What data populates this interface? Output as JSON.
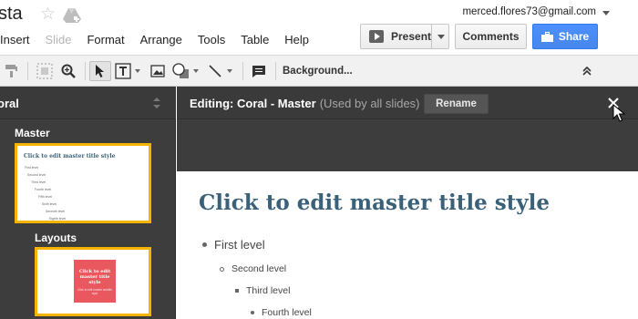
{
  "app": {
    "doc_title": "sta",
    "account_email": "merced.flores73@gmail.com"
  },
  "icons": {
    "star": "star-icon",
    "drive": "drive-icon",
    "present": "play-icon",
    "share": "share-icon",
    "close": "close-icon"
  },
  "menu": {
    "items": [
      "Insert",
      "Slide",
      "Format",
      "Arrange",
      "Tools",
      "Table",
      "Help"
    ],
    "disabled": [
      "Slide"
    ]
  },
  "header_buttons": {
    "present_label": "Present",
    "comments_label": "Comments",
    "share_label": "Share"
  },
  "toolbar": {
    "background_label": "Background..."
  },
  "left_panel": {
    "title": "oral",
    "master_heading": "Master",
    "layouts_heading": "Layouts",
    "master_thumb": {
      "title": "Click to edit master title style",
      "levels": [
        "First level",
        "Second level",
        "Third level",
        "Fourth level",
        "Fifth level",
        "Sixth level",
        "Seventh level",
        "Eighth level",
        "Ninth level"
      ]
    },
    "layout_thumb": {
      "title": "Click to edit master title style",
      "subtitle": "Click to edit master subtitle style"
    }
  },
  "editing_bar": {
    "title": "Editing: Coral - Master",
    "subtitle": "(Used by all slides)",
    "rename_label": "Rename"
  },
  "slide": {
    "title": "Click to edit master title style",
    "levels": [
      "First level",
      "Second level",
      "Third level",
      "Fourth level"
    ]
  },
  "colors": {
    "accent_yellow": "#f4b400",
    "share_blue": "#4d90fe",
    "slide_title": "#3b6178",
    "coral": "#e8585e",
    "dark_panel": "#3d3d3d"
  }
}
